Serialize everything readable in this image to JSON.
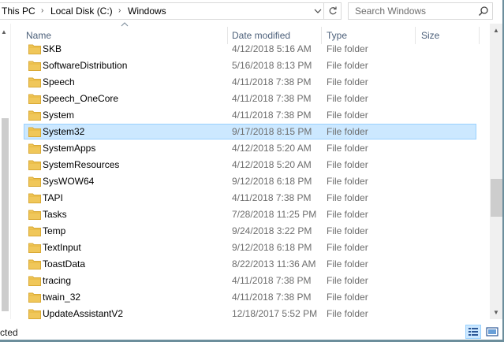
{
  "address_bar": {
    "breadcrumbs": [
      "This PC",
      "Local Disk (C:)",
      "Windows"
    ]
  },
  "search": {
    "placeholder": "Search Windows"
  },
  "columns": {
    "name": "Name",
    "date": "Date modified",
    "type": "Type",
    "size": "Size"
  },
  "rows": [
    {
      "name": "SKB",
      "date": "4/12/2018 5:16 AM",
      "type": "File folder",
      "selected": false
    },
    {
      "name": "SoftwareDistribution",
      "date": "5/16/2018 8:13 PM",
      "type": "File folder",
      "selected": false
    },
    {
      "name": "Speech",
      "date": "4/11/2018 7:38 PM",
      "type": "File folder",
      "selected": false
    },
    {
      "name": "Speech_OneCore",
      "date": "4/11/2018 7:38 PM",
      "type": "File folder",
      "selected": false
    },
    {
      "name": "System",
      "date": "4/11/2018 7:38 PM",
      "type": "File folder",
      "selected": false
    },
    {
      "name": "System32",
      "date": "9/17/2018 8:15 PM",
      "type": "File folder",
      "selected": true
    },
    {
      "name": "SystemApps",
      "date": "4/12/2018 5:20 AM",
      "type": "File folder",
      "selected": false
    },
    {
      "name": "SystemResources",
      "date": "4/12/2018 5:20 AM",
      "type": "File folder",
      "selected": false
    },
    {
      "name": "SysWOW64",
      "date": "9/12/2018 6:18 PM",
      "type": "File folder",
      "selected": false
    },
    {
      "name": "TAPI",
      "date": "4/11/2018 7:38 PM",
      "type": "File folder",
      "selected": false
    },
    {
      "name": "Tasks",
      "date": "7/28/2018 11:25 PM",
      "type": "File folder",
      "selected": false
    },
    {
      "name": "Temp",
      "date": "9/24/2018 3:22 PM",
      "type": "File folder",
      "selected": false
    },
    {
      "name": "TextInput",
      "date": "9/12/2018 6:18 PM",
      "type": "File folder",
      "selected": false
    },
    {
      "name": "ToastData",
      "date": "8/22/2013 11:36 AM",
      "type": "File folder",
      "selected": false
    },
    {
      "name": "tracing",
      "date": "4/11/2018 7:38 PM",
      "type": "File folder",
      "selected": false
    },
    {
      "name": "twain_32",
      "date": "4/11/2018 7:38 PM",
      "type": "File folder",
      "selected": false
    },
    {
      "name": "UpdateAssistantV2",
      "date": "12/18/2017 5:52 PM",
      "type": "File folder",
      "selected": false
    }
  ],
  "status": {
    "text": "cted"
  },
  "colors": {
    "selection_bg": "#cce8ff",
    "selection_border": "#99d1ff",
    "folder": "#f0c75a",
    "header_text": "#4c607a"
  },
  "icons": {
    "folder": "folder-icon",
    "search": "search-icon",
    "refresh": "refresh-icon",
    "dropdown": "chevron-down-icon"
  }
}
